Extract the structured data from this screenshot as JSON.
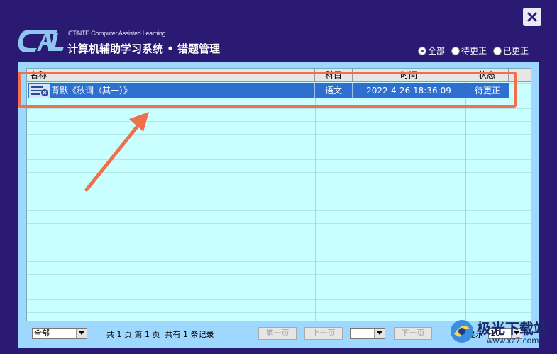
{
  "header": {
    "brand_small": "CTiNTE Computer Assisted Learning",
    "title": "计算机辅助学习系统 • 错题管理"
  },
  "filters": [
    {
      "label": "全部",
      "checked": true
    },
    {
      "label": "待更正",
      "checked": false
    },
    {
      "label": "已更正",
      "checked": false
    }
  ],
  "table": {
    "columns": [
      "名称",
      "科目",
      "时间",
      "状态"
    ],
    "rows": [
      {
        "name": "背默《秋词（其一）》",
        "subject": "语文",
        "time": "2022-4-26 18:36:09",
        "status": "待更正"
      }
    ]
  },
  "footer": {
    "filter_value": "全部",
    "page_info": "共 1 页 第 1 页  共有 1 条记录",
    "first_page": "第一页",
    "prev_page": "上一页",
    "page_select": "",
    "next_page": "下一页",
    "per_page_label": "每页显示",
    "per_page_value": "10"
  },
  "watermark": {
    "line1": "极光下载站",
    "line2": "www.xz7.com"
  },
  "colors": {
    "background": "#2b1a73",
    "selected_row": "#2f6fcf",
    "highlight": "#f26f4b"
  }
}
